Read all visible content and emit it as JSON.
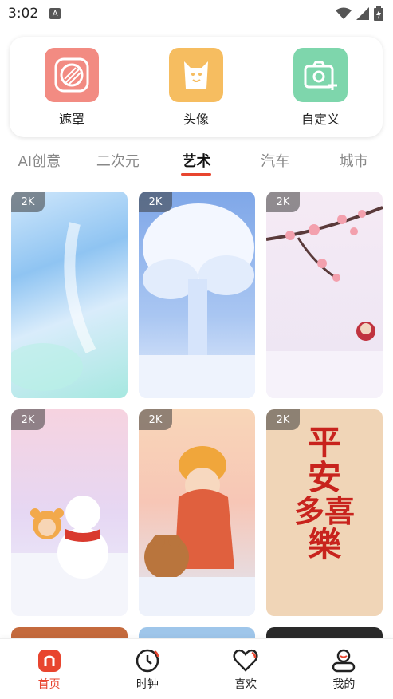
{
  "status": {
    "time": "3:02",
    "notif": "A"
  },
  "tools": [
    {
      "label": "遮罩",
      "icon": "mask-icon",
      "color": "#f28b82"
    },
    {
      "label": "头像",
      "icon": "avatar-cat-icon",
      "color": "#f6bd60"
    },
    {
      "label": "自定义",
      "icon": "camera-plus-icon",
      "color": "#7ed6ac"
    }
  ],
  "tabs": [
    "AI创意",
    "二次元",
    "艺术",
    "汽车",
    "城市"
  ],
  "active_tab": "艺术",
  "badge": "2K",
  "wallpapers": [
    {
      "icon": "blue-gradient-image"
    },
    {
      "icon": "snowy-tree-image"
    },
    {
      "icon": "cherry-blossom-snow-image"
    },
    {
      "icon": "snowman-bear-image"
    },
    {
      "icon": "girl-with-bear-image"
    },
    {
      "icon": "calligraphy-image",
      "text": [
        "平",
        "安",
        "多喜",
        "樂"
      ]
    }
  ],
  "nav": [
    {
      "label": "首页",
      "icon": "home-icon",
      "active": true
    },
    {
      "label": "时钟",
      "icon": "clock-icon"
    },
    {
      "label": "喜欢",
      "icon": "heart-icon"
    },
    {
      "label": "我的",
      "icon": "profile-icon"
    }
  ],
  "colors": {
    "accent": "#e8452f"
  }
}
